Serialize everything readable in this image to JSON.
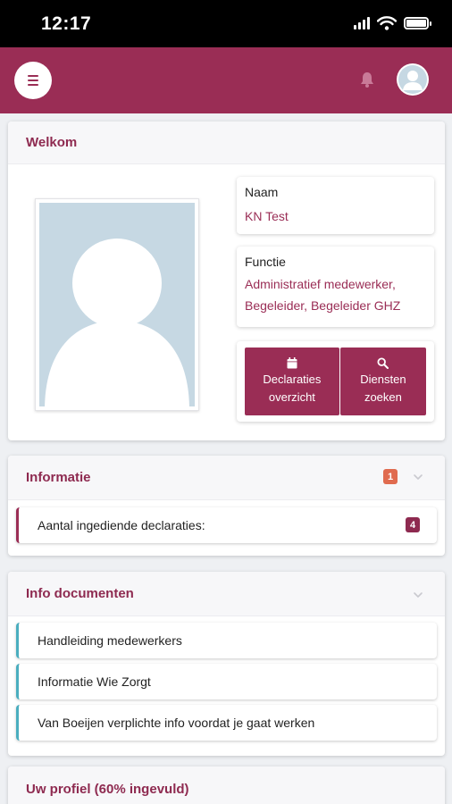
{
  "status_bar": {
    "time": "12:17"
  },
  "header": {
    "menu_icon": "hamburger-menu-icon",
    "notification_icon": "bell-icon",
    "avatar_icon": "user-avatar-icon"
  },
  "welcome": {
    "title": "Welkom",
    "name_label": "Naam",
    "name_value": "KN Test",
    "function_label": "Functie",
    "function_value_line1": "Administratief medewerker,",
    "function_value_line2": "Begeleider, Begeleider GHZ",
    "buttons": [
      {
        "icon": "calendar-icon",
        "line1": "Declaraties",
        "line2": "overzicht"
      },
      {
        "icon": "search-icon",
        "line1": "Diensten",
        "line2": "zoeken"
      }
    ]
  },
  "informatie": {
    "title": "Informatie",
    "badge": "1",
    "items": [
      {
        "label": "Aantal ingediende declaraties:",
        "count": "4"
      }
    ]
  },
  "info_documenten": {
    "title": "Info documenten",
    "items": [
      {
        "label": "Handleiding medewerkers"
      },
      {
        "label": "Informatie Wie Zorgt"
      },
      {
        "label": "Van Boeijen verplichte info voordat je gaat werken"
      }
    ]
  },
  "profile": {
    "title": "Uw profiel (60% ingevuld)",
    "completion_percent": 60
  },
  "colors": {
    "primary": "#9a2d55",
    "accent_teal": "#4aaebf",
    "badge_red": "#e06b4f"
  }
}
